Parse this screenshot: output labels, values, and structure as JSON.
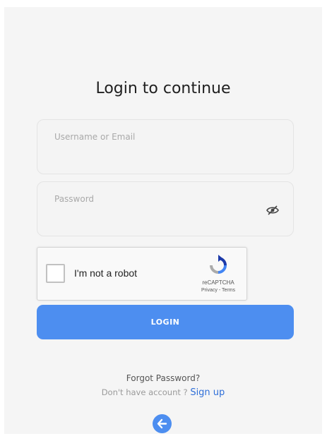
{
  "title": "Login to continue",
  "username": {
    "placeholder": "Username or Email",
    "value": ""
  },
  "password": {
    "placeholder": "Password",
    "value": "",
    "toggle_icon": "eye-slash-icon"
  },
  "captcha": {
    "label": "I'm not a robot",
    "brand": "reCAPTCHA",
    "privacy": "Privacy",
    "separator": " - ",
    "terms": "Terms",
    "checked": false
  },
  "login_button": "LOGIN",
  "forgot_password": "Forgot Password?",
  "signup": {
    "prompt": "Don't have account ? ",
    "link": "Sign up"
  },
  "back_icon": "arrow-left-icon",
  "colors": {
    "accent": "#4d8ef0",
    "link": "#2f6fd8",
    "background": "#f5f5f5"
  }
}
